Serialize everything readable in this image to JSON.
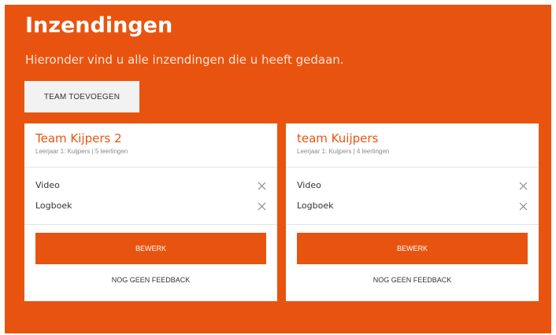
{
  "header": {
    "title": "Inzendingen",
    "subtitle": "Hieronder vind u alle inzendingen die u heeft gedaan."
  },
  "actions": {
    "add_team_label": "TEAM TOEVOEGEN"
  },
  "cards": [
    {
      "title": "Team Kijpers 2",
      "meta": "Leerjaar 1: Kuijpers | 5 leerlingen",
      "items": [
        {
          "label": "Video",
          "icon": "close-icon"
        },
        {
          "label": "Logboek",
          "icon": "close-icon"
        }
      ],
      "edit_label": "BEWERK",
      "feedback_text": "NOG GEEN FEEDBACK"
    },
    {
      "title": "team Kuijpers",
      "meta": "Leerjaar 1: Kuijpers | 4 leerlingen",
      "items": [
        {
          "label": "Video",
          "icon": "close-icon"
        },
        {
          "label": "Logboek",
          "icon": "close-icon"
        }
      ],
      "edit_label": "BEWERK",
      "feedback_text": "NOG GEEN FEEDBACK"
    }
  ],
  "colors": {
    "accent": "#e8540f",
    "card_background": "#ffffff",
    "button_light": "#f2f2f2"
  }
}
